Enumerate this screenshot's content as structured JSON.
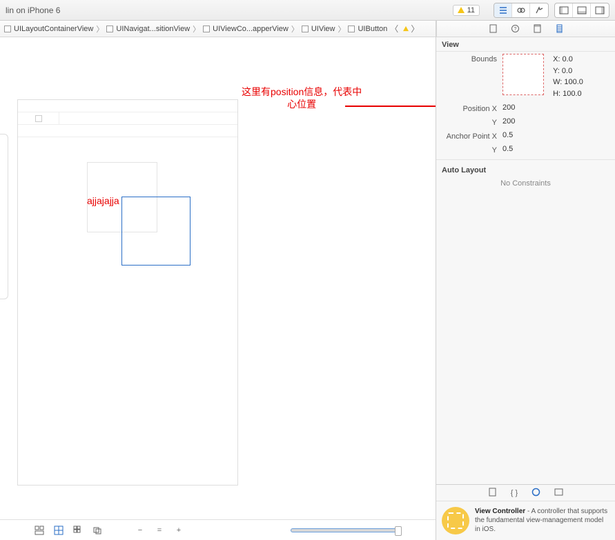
{
  "toolbar": {
    "title": "lin on iPhone 6",
    "warning_count": "11"
  },
  "breadcrumb": {
    "items": [
      "UILayoutContainerView",
      "UINavigat...sitionView",
      "UIViewCo...apperView",
      "UIView",
      "UIButton"
    ]
  },
  "annotation": {
    "line1": "这里有position信息，代表中",
    "line2": "心位置"
  },
  "canvas": {
    "label_text": "ajjajajja"
  },
  "inspector": {
    "section": "View",
    "bounds_label": "Bounds",
    "bounds": {
      "x_label": "X:",
      "x": "0.0",
      "y_label": "Y:",
      "y": "0.0",
      "w_label": "W:",
      "w": "100.0",
      "h_label": "H:",
      "h": "100.0"
    },
    "position": {
      "x_label": "Position X",
      "x": "200",
      "y_label": "Y",
      "y": "200"
    },
    "anchor": {
      "x_label": "Anchor Point X",
      "x": "0.5",
      "y_label": "Y",
      "y": "0.5"
    },
    "auto_layout_label": "Auto Layout",
    "no_constraints": "No Constraints"
  },
  "library": {
    "title": "View Controller",
    "desc": " - A controller that supports the fundamental view-management model in iOS."
  }
}
